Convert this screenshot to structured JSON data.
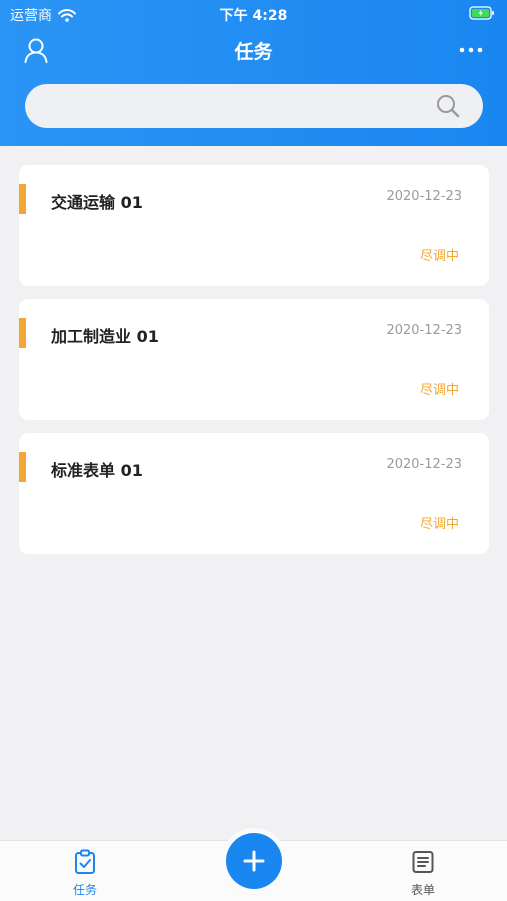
{
  "status_bar": {
    "carrier": "运营商",
    "time": "下午 4:28"
  },
  "nav": {
    "title": "任务",
    "left_icon": "user-icon",
    "right_icon": "more-icon"
  },
  "search": {
    "value": "",
    "placeholder": ""
  },
  "tasks": [
    {
      "name": "交通运输 01",
      "date": "2020-12-23",
      "status": "尽调中"
    },
    {
      "name": "加工制造业 01",
      "date": "2020-12-23",
      "status": "尽调中"
    },
    {
      "name": "标准表单 01",
      "date": "2020-12-23",
      "status": "尽调中"
    }
  ],
  "tab_bar": {
    "tabs": [
      {
        "label": "任务",
        "icon": "clipboard-check-icon",
        "active": true
      },
      {
        "label": "表单",
        "icon": "document-list-icon",
        "active": false
      }
    ],
    "fab_icon": "plus-icon"
  },
  "colors": {
    "primary": "#1a86f0",
    "accent": "#f2a735",
    "background": "#f1f1f4"
  }
}
